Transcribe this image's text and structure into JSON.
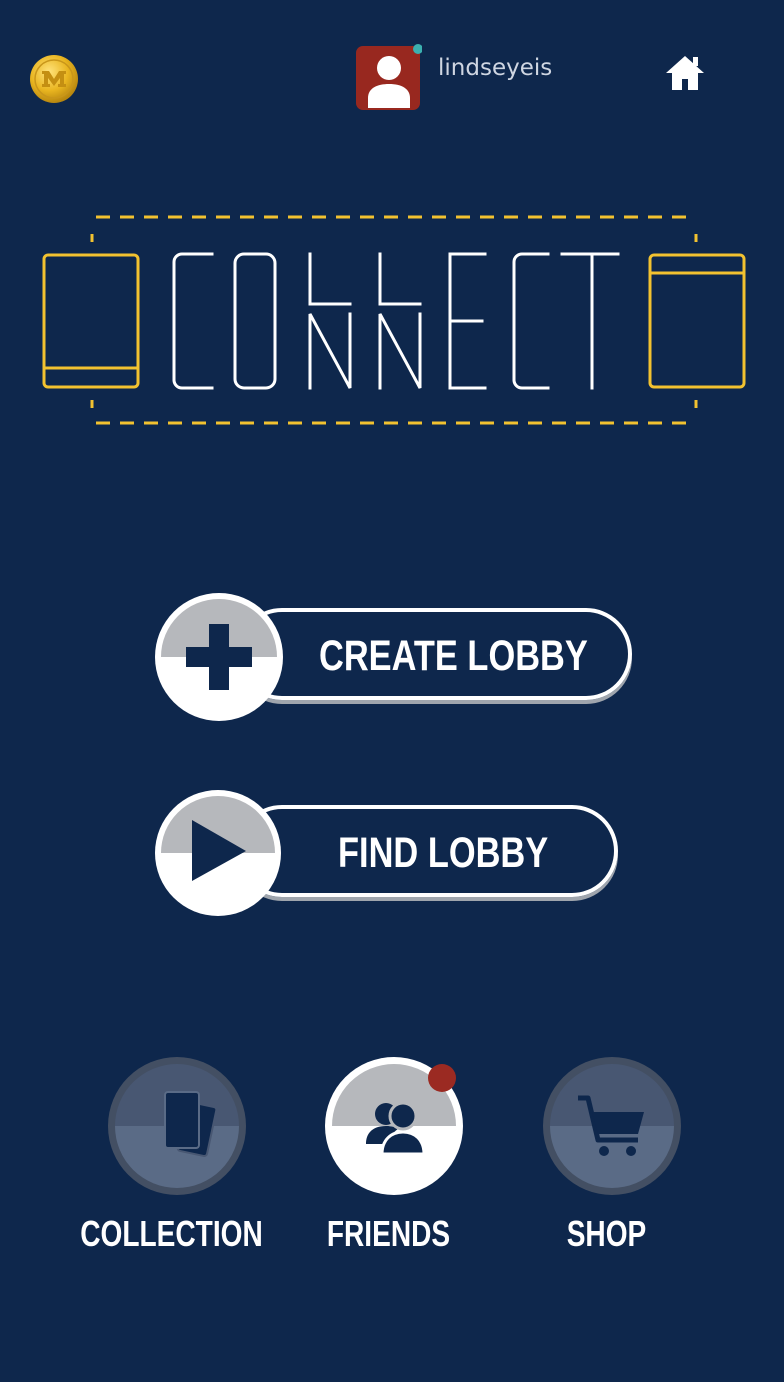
{
  "header": {
    "coin_icon": "m-coin-icon",
    "avatar_icon": "user-avatar-icon",
    "username": "lindseyeis",
    "home_icon": "home-icon",
    "online_color": "#3bb0b0"
  },
  "logo": {
    "text": "COLLECT CONNECT",
    "lines": [
      "CO",
      "LL",
      "NN",
      "ECT"
    ]
  },
  "lobby_buttons": {
    "create_label": "CREATE LOBBY",
    "create_icon": "plus-icon",
    "find_label": "FIND LOBBY",
    "find_icon": "play-icon"
  },
  "nav": {
    "items": [
      {
        "label": "COLLECTION",
        "icon": "cards-icon",
        "active": false
      },
      {
        "label": "FRIENDS",
        "icon": "friends-icon",
        "active": true,
        "has_notification": true
      },
      {
        "label": "SHOP",
        "icon": "cart-icon",
        "active": false
      }
    ]
  },
  "colors": {
    "background": "#0e274c",
    "accent_yellow": "#f2c230",
    "notification": "#9b2a22",
    "avatar_bg": "#98281f"
  }
}
